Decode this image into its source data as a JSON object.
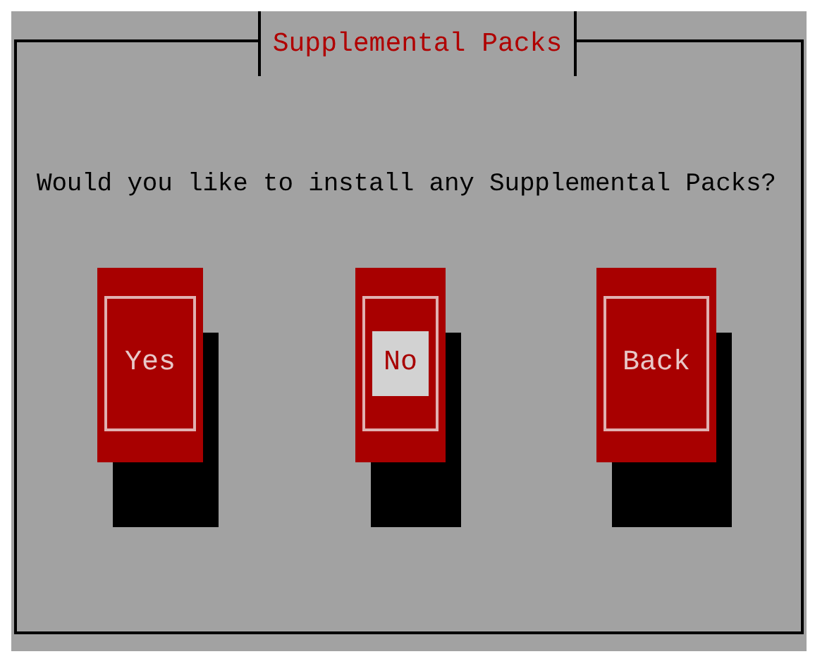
{
  "dialog": {
    "title": "Supplemental Packs",
    "question": "Would you like to install any Supplemental Packs?",
    "buttons": [
      {
        "label": "Yes",
        "selected": false
      },
      {
        "label": "No",
        "selected": true
      },
      {
        "label": "Back",
        "selected": false
      }
    ]
  }
}
